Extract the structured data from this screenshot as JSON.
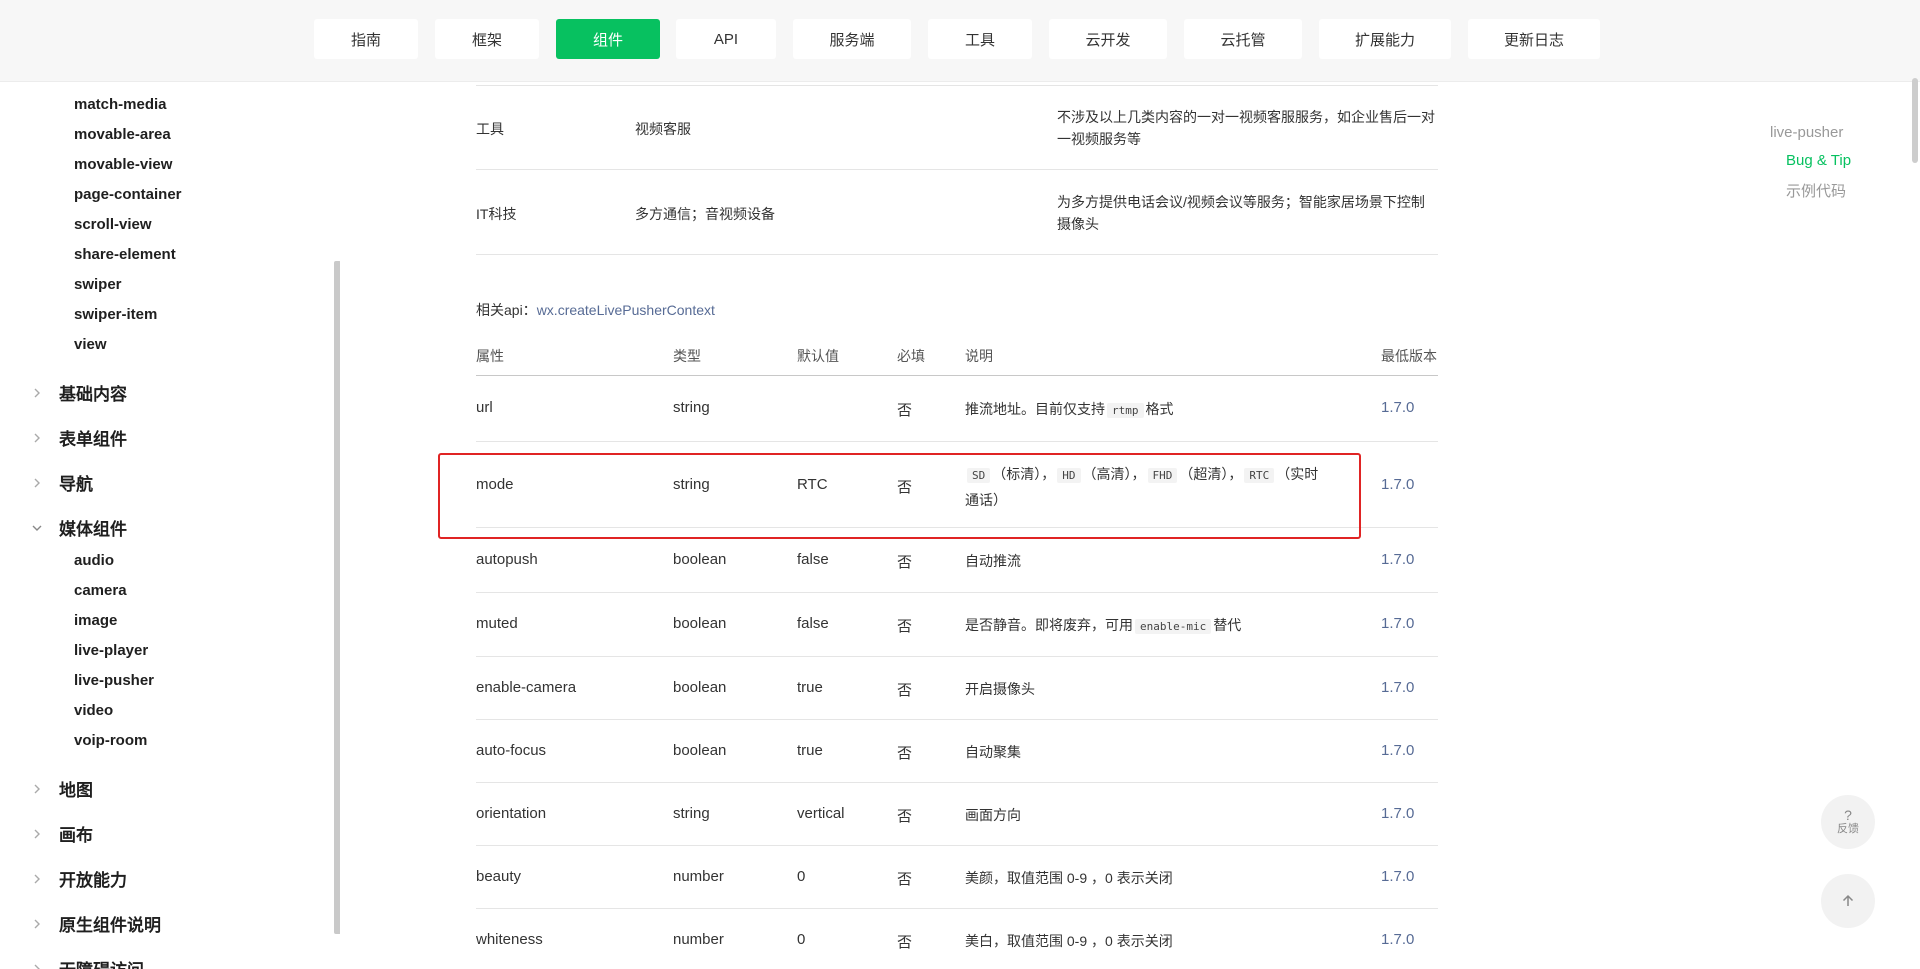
{
  "nav": {
    "tabs": [
      "指南",
      "框架",
      "组件",
      "API",
      "服务端",
      "工具",
      "云开发",
      "云托管",
      "扩展能力",
      "更新日志"
    ],
    "active": "组件"
  },
  "sidebar": {
    "sub_items_top": [
      "match-media",
      "movable-area",
      "movable-view",
      "page-container",
      "scroll-view",
      "share-element",
      "swiper",
      "swiper-item",
      "view"
    ],
    "categories_a": [
      "基础内容",
      "表单组件",
      "导航"
    ],
    "media_category": "媒体组件",
    "media_items": [
      "audio",
      "camera",
      "image",
      "live-player",
      "live-pusher",
      "video",
      "voip-room"
    ],
    "categories_b": [
      "地图",
      "画布",
      "开放能力",
      "原生组件说明",
      "无障碍访问"
    ]
  },
  "scenarios": [
    {
      "category": "工具",
      "scene": "视频客服",
      "desc": "不涉及以上几类内容的一对一视频客服服务，如企业售后一对一视频服务等"
    },
    {
      "category": "IT科技",
      "scene": "多方通信；音视频设备",
      "desc": "为多方提供电话会议/视频会议等服务；智能家居场景下控制摄像头"
    }
  ],
  "related_api": {
    "label": "相关api：",
    "link": "wx.createLivePusherContext"
  },
  "table": {
    "headers": [
      "属性",
      "类型",
      "默认值",
      "必填",
      "说明",
      "最低版本"
    ],
    "rows": [
      {
        "name": "url",
        "type": "string",
        "default": "",
        "required": "否",
        "version": "1.7.0"
      },
      {
        "name": "mode",
        "type": "string",
        "default": "RTC",
        "required": "否",
        "version": "1.7.0"
      },
      {
        "name": "autopush",
        "type": "boolean",
        "default": "false",
        "required": "否",
        "version": "1.7.0"
      },
      {
        "name": "muted",
        "type": "boolean",
        "default": "false",
        "required": "否",
        "version": "1.7.0"
      },
      {
        "name": "enable-camera",
        "type": "boolean",
        "default": "true",
        "required": "否",
        "version": "1.7.0"
      },
      {
        "name": "auto-focus",
        "type": "boolean",
        "default": "true",
        "required": "否",
        "version": "1.7.0"
      },
      {
        "name": "orientation",
        "type": "string",
        "default": "vertical",
        "required": "否",
        "version": "1.7.0"
      },
      {
        "name": "beauty",
        "type": "number",
        "default": "0",
        "required": "否",
        "version": "1.7.0"
      },
      {
        "name": "whiteness",
        "type": "number",
        "default": "0",
        "required": "否",
        "version": "1.7.0"
      }
    ],
    "desc": {
      "url_text": "推流地址。目前仅支持",
      "url_code": "rtmp",
      "url_suffix": "格式",
      "mode_code1": "SD",
      "mode_text1": "（标清），",
      "mode_code2": "HD",
      "mode_text2": "（高清），",
      "mode_code3": "FHD",
      "mode_text3": "（超清），",
      "mode_code4": "RTC",
      "mode_text4": "（实时通话）",
      "autopush": "自动推流",
      "muted_text": "是否静音。即将废弃，可用",
      "muted_code": "enable-mic",
      "muted_suffix": "替代",
      "enable_camera": "开启摄像头",
      "auto_focus": "自动聚集",
      "orientation": "画面方向",
      "beauty": "美颜，取值范围 0-9 ，0 表示关闭",
      "whiteness": "美白，取值范围 0-9 ，0 表示关闭"
    }
  },
  "toc": [
    "live-pusher",
    "Bug & Tip",
    "示例代码"
  ],
  "toc_active": "Bug & Tip",
  "feedback": {
    "icon": "?",
    "label": "反馈"
  },
  "colors": {
    "accent": "#07c160",
    "link": "#576b95",
    "highlight": "#e02424"
  }
}
